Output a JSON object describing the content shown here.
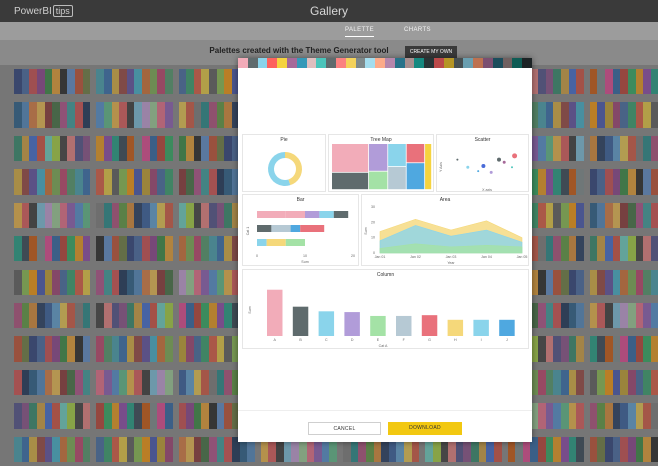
{
  "app": {
    "logo_text": "PowerBI",
    "logo_badge": "tips",
    "title": "Gallery"
  },
  "tabs": [
    {
      "label": "PALETTE",
      "active": true
    },
    {
      "label": "CHARTS",
      "active": false
    }
  ],
  "headline": "Palettes created with the Theme Generator tool",
  "create_button": "CREATE MY OWN",
  "background_palettes": [
    [
      "#233a7a",
      "#3f67a6",
      "#d0474a",
      "#8c3b8d",
      "#2f8a3b",
      "#f0a12a",
      "#1c1c1c",
      "#5a8ed0",
      "#c64b2a",
      "#6b7c3a"
    ],
    [
      "#4c9a6a",
      "#3fa3b4",
      "#2c6cb1",
      "#e0b23a",
      "#9a3e3a",
      "#5c4aa5",
      "#3bb5d3",
      "#d86e2b",
      "#7ab04f",
      "#c33d6a"
    ],
    [
      "#c9a227",
      "#a23b72",
      "#3d6aa6",
      "#2ea36b",
      "#e3563b",
      "#f2d03b",
      "#5a5a5a",
      "#8bc34a",
      "#ff9800",
      "#3f51b5"
    ],
    [
      "#0e2a54",
      "#1e5b8a",
      "#4a89c4",
      "#e07b39",
      "#f5c04a",
      "#8a2d2d",
      "#3b6e3b",
      "#b64c8a",
      "#35a0a0",
      "#d94a4a"
    ],
    [
      "#ef6c8b",
      "#8e5bb8",
      "#4e91d6",
      "#5bbf8a",
      "#f5b942",
      "#e35757",
      "#333333",
      "#7bc4e3",
      "#c9a0dc",
      "#9fd39a"
    ],
    [
      "#19335e",
      "#2c5aa0",
      "#5ba2d9",
      "#f2cc4a",
      "#d9533b",
      "#7d7d7d",
      "#1b8a8a",
      "#b34a7d",
      "#5a9c3a",
      "#e08b2e"
    ],
    [
      "#4a4a8a",
      "#8a4a8a",
      "#2a8a6a",
      "#d8a23a",
      "#3a6ad8",
      "#d84a3a",
      "#6ad8c8",
      "#a8d83a",
      "#383838",
      "#f08080"
    ],
    [
      "#2563a8",
      "#c0392b",
      "#27ae60",
      "#f39c12",
      "#8e44ad",
      "#16a085",
      "#2c3e50",
      "#d35400",
      "#7f8c8d",
      "#e84393"
    ]
  ],
  "modal": {
    "swatches": [
      "#f2acb9",
      "#5f6b6d",
      "#8ad4eb",
      "#fd625e",
      "#f5d33f",
      "#a66999",
      "#3599b8",
      "#dfbfbf",
      "#4ac5bb",
      "#5f6b6d",
      "#fb8281",
      "#f4d25a",
      "#7f898a",
      "#a4ddee",
      "#fdab89",
      "#b687ac",
      "#28738a",
      "#a78f8f",
      "#168980",
      "#293537",
      "#bb4a4a",
      "#b59525",
      "#475052",
      "#6a9fb0",
      "#bd7150",
      "#7b4f71",
      "#1b4d5c",
      "#706060",
      "#0f5c55",
      "#1c2325"
    ],
    "charts": {
      "pie": {
        "title": "Pie"
      },
      "treemap": {
        "title": "Tree Map"
      },
      "scatter": {
        "title": "Scatter",
        "ylabel": "Y Axis",
        "xlabel": "X axis"
      },
      "bar": {
        "title": "Bar",
        "ylabel": "Cat 1",
        "xlabel": "Sum"
      },
      "area": {
        "title": "Area",
        "ylabel": "Sum",
        "xlabel": "Year"
      },
      "column": {
        "title": "Column",
        "ylabel": "Sum",
        "xlabel": "Cat A"
      }
    },
    "cancel_label": "CANCEL",
    "download_label": "DOWNLOAD"
  },
  "chart_data": [
    {
      "type": "pie",
      "title": "Pie",
      "slices": [
        {
          "value": 45,
          "color": "#f5d87a"
        },
        {
          "value": 55,
          "color": "#8ad4eb"
        }
      ]
    },
    {
      "type": "heatmap",
      "title": "Tree Map",
      "tiles": [
        {
          "value": 30,
          "color": "#f2acb9"
        },
        {
          "value": 15,
          "color": "#b19cd9"
        },
        {
          "value": 12,
          "color": "#8ad4eb"
        },
        {
          "value": 18,
          "color": "#5f6b6d"
        },
        {
          "value": 10,
          "color": "#a4e2a6"
        },
        {
          "value": 12,
          "color": "#b6c9d4"
        },
        {
          "value": 10,
          "color": "#e9717b"
        },
        {
          "value": 9,
          "color": "#f5d33f"
        },
        {
          "value": 14,
          "color": "#4fa8e0"
        }
      ]
    },
    {
      "type": "scatter",
      "title": "Scatter",
      "xlabel": "X axis",
      "ylabel": "Y Axis",
      "xlim": [
        0,
        30
      ],
      "ylim": [
        0,
        30
      ],
      "points": [
        {
          "x": 4,
          "y": 20,
          "r": 1,
          "color": "#5f6b6d"
        },
        {
          "x": 8,
          "y": 14,
          "r": 1.5,
          "color": "#8ad4eb"
        },
        {
          "x": 12,
          "y": 11,
          "r": 1,
          "color": "#4fa8e0"
        },
        {
          "x": 14,
          "y": 15,
          "r": 2,
          "color": "#4a6bd8"
        },
        {
          "x": 17,
          "y": 10,
          "r": 1.5,
          "color": "#b19cd9"
        },
        {
          "x": 20,
          "y": 20,
          "r": 2,
          "color": "#5f6b6d"
        },
        {
          "x": 22,
          "y": 18,
          "r": 1.5,
          "color": "#a66999"
        },
        {
          "x": 26,
          "y": 23,
          "r": 2.5,
          "color": "#e9717b"
        },
        {
          "x": 25,
          "y": 14,
          "r": 1,
          "color": "#4ac5bb"
        }
      ]
    },
    {
      "type": "bar",
      "title": "Bar",
      "xlabel": "Sum",
      "ylabel": "Cat 1",
      "xlim": [
        0,
        20
      ],
      "ticks": [
        "0",
        "10",
        "20"
      ],
      "rows": [
        [
          {
            "value": 6,
            "color": "#f2acb9"
          },
          {
            "value": 4,
            "color": "#f2acb9"
          },
          {
            "value": 3,
            "color": "#b19cd9"
          },
          {
            "value": 3,
            "color": "#8ad4eb"
          },
          {
            "value": 3,
            "color": "#5f6b6d"
          }
        ],
        [
          {
            "value": 3,
            "color": "#5f6b6d"
          },
          {
            "value": 4,
            "color": "#b6c9d4"
          },
          {
            "value": 2,
            "color": "#4fa8e0"
          },
          {
            "value": 5,
            "color": "#e9717b"
          }
        ],
        [
          {
            "value": 2,
            "color": "#8ad4eb"
          },
          {
            "value": 4,
            "color": "#f5d87a"
          },
          {
            "value": 4,
            "color": "#a4e2a6"
          },
          {
            "value": 5,
            "color": "#ffffff"
          }
        ]
      ]
    },
    {
      "type": "area",
      "title": "Area",
      "xlabel": "Year",
      "ylabel": "Sum",
      "categories": [
        "Jan 01",
        "Jan 02",
        "Jan 03",
        "Jan 04",
        "Jan 05"
      ],
      "ylim": [
        0,
        30
      ],
      "yticks": [
        "0",
        "10",
        "20",
        "30"
      ],
      "series": [
        {
          "values": [
            14,
            22,
            15,
            21,
            10
          ],
          "color": "#f5d87a"
        },
        {
          "values": [
            8,
            18,
            11,
            15,
            7
          ],
          "color": "#8ad4eb"
        },
        {
          "values": [
            3,
            6,
            4,
            5,
            4
          ],
          "color": "#a4e2a6"
        }
      ]
    },
    {
      "type": "bar",
      "title": "Column",
      "xlabel": "Cat A",
      "ylabel": "Sum",
      "categories": [
        "A",
        "B",
        "C",
        "D",
        "E",
        "F",
        "G",
        "H",
        "I",
        "J"
      ],
      "values": [
        60,
        38,
        32,
        31,
        26,
        26,
        27,
        21,
        21,
        21
      ],
      "colors": [
        "#f2acb9",
        "#5f6b6d",
        "#8ad4eb",
        "#b19cd9",
        "#a4e2a6",
        "#b6c9d4",
        "#e9717b",
        "#f5d87a",
        "#8ad4eb",
        "#4fa8e0"
      ],
      "ylim": [
        0,
        70
      ]
    }
  ]
}
